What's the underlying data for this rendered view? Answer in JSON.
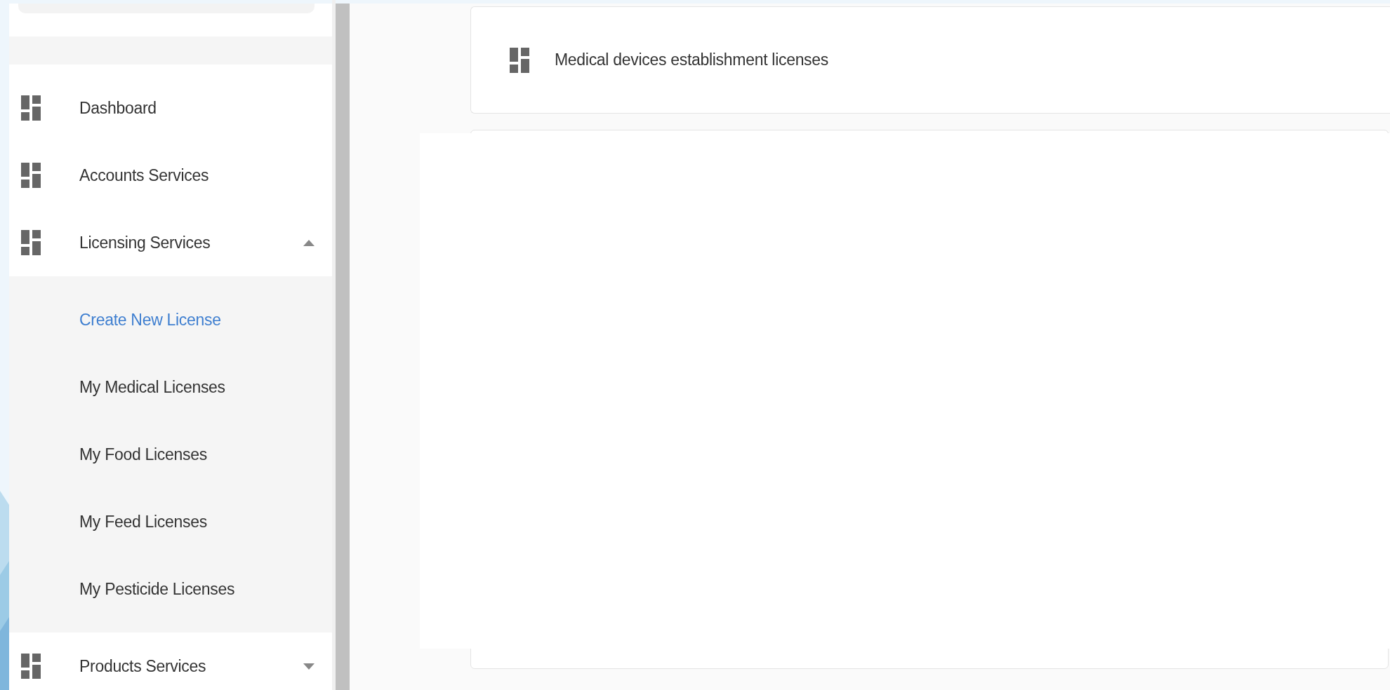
{
  "sidebar": {
    "items": [
      {
        "kind": "link",
        "label": "Dashboard"
      },
      {
        "kind": "link",
        "label": "Accounts Services"
      },
      {
        "kind": "group",
        "label": "Licensing Services",
        "expanded": true,
        "children": [
          {
            "label": "Create New License",
            "selected": true
          },
          {
            "label": "My Medical Licenses",
            "selected": false
          },
          {
            "label": "My Food Licenses",
            "selected": false
          },
          {
            "label": "My Feed Licenses",
            "selected": false
          },
          {
            "label": "My Pesticide Licenses",
            "selected": false
          }
        ]
      },
      {
        "kind": "group",
        "label": "Products Services",
        "expanded": false
      }
    ]
  },
  "main": {
    "cards": [
      {
        "label": "Medical devices establishment licenses"
      }
    ]
  }
}
